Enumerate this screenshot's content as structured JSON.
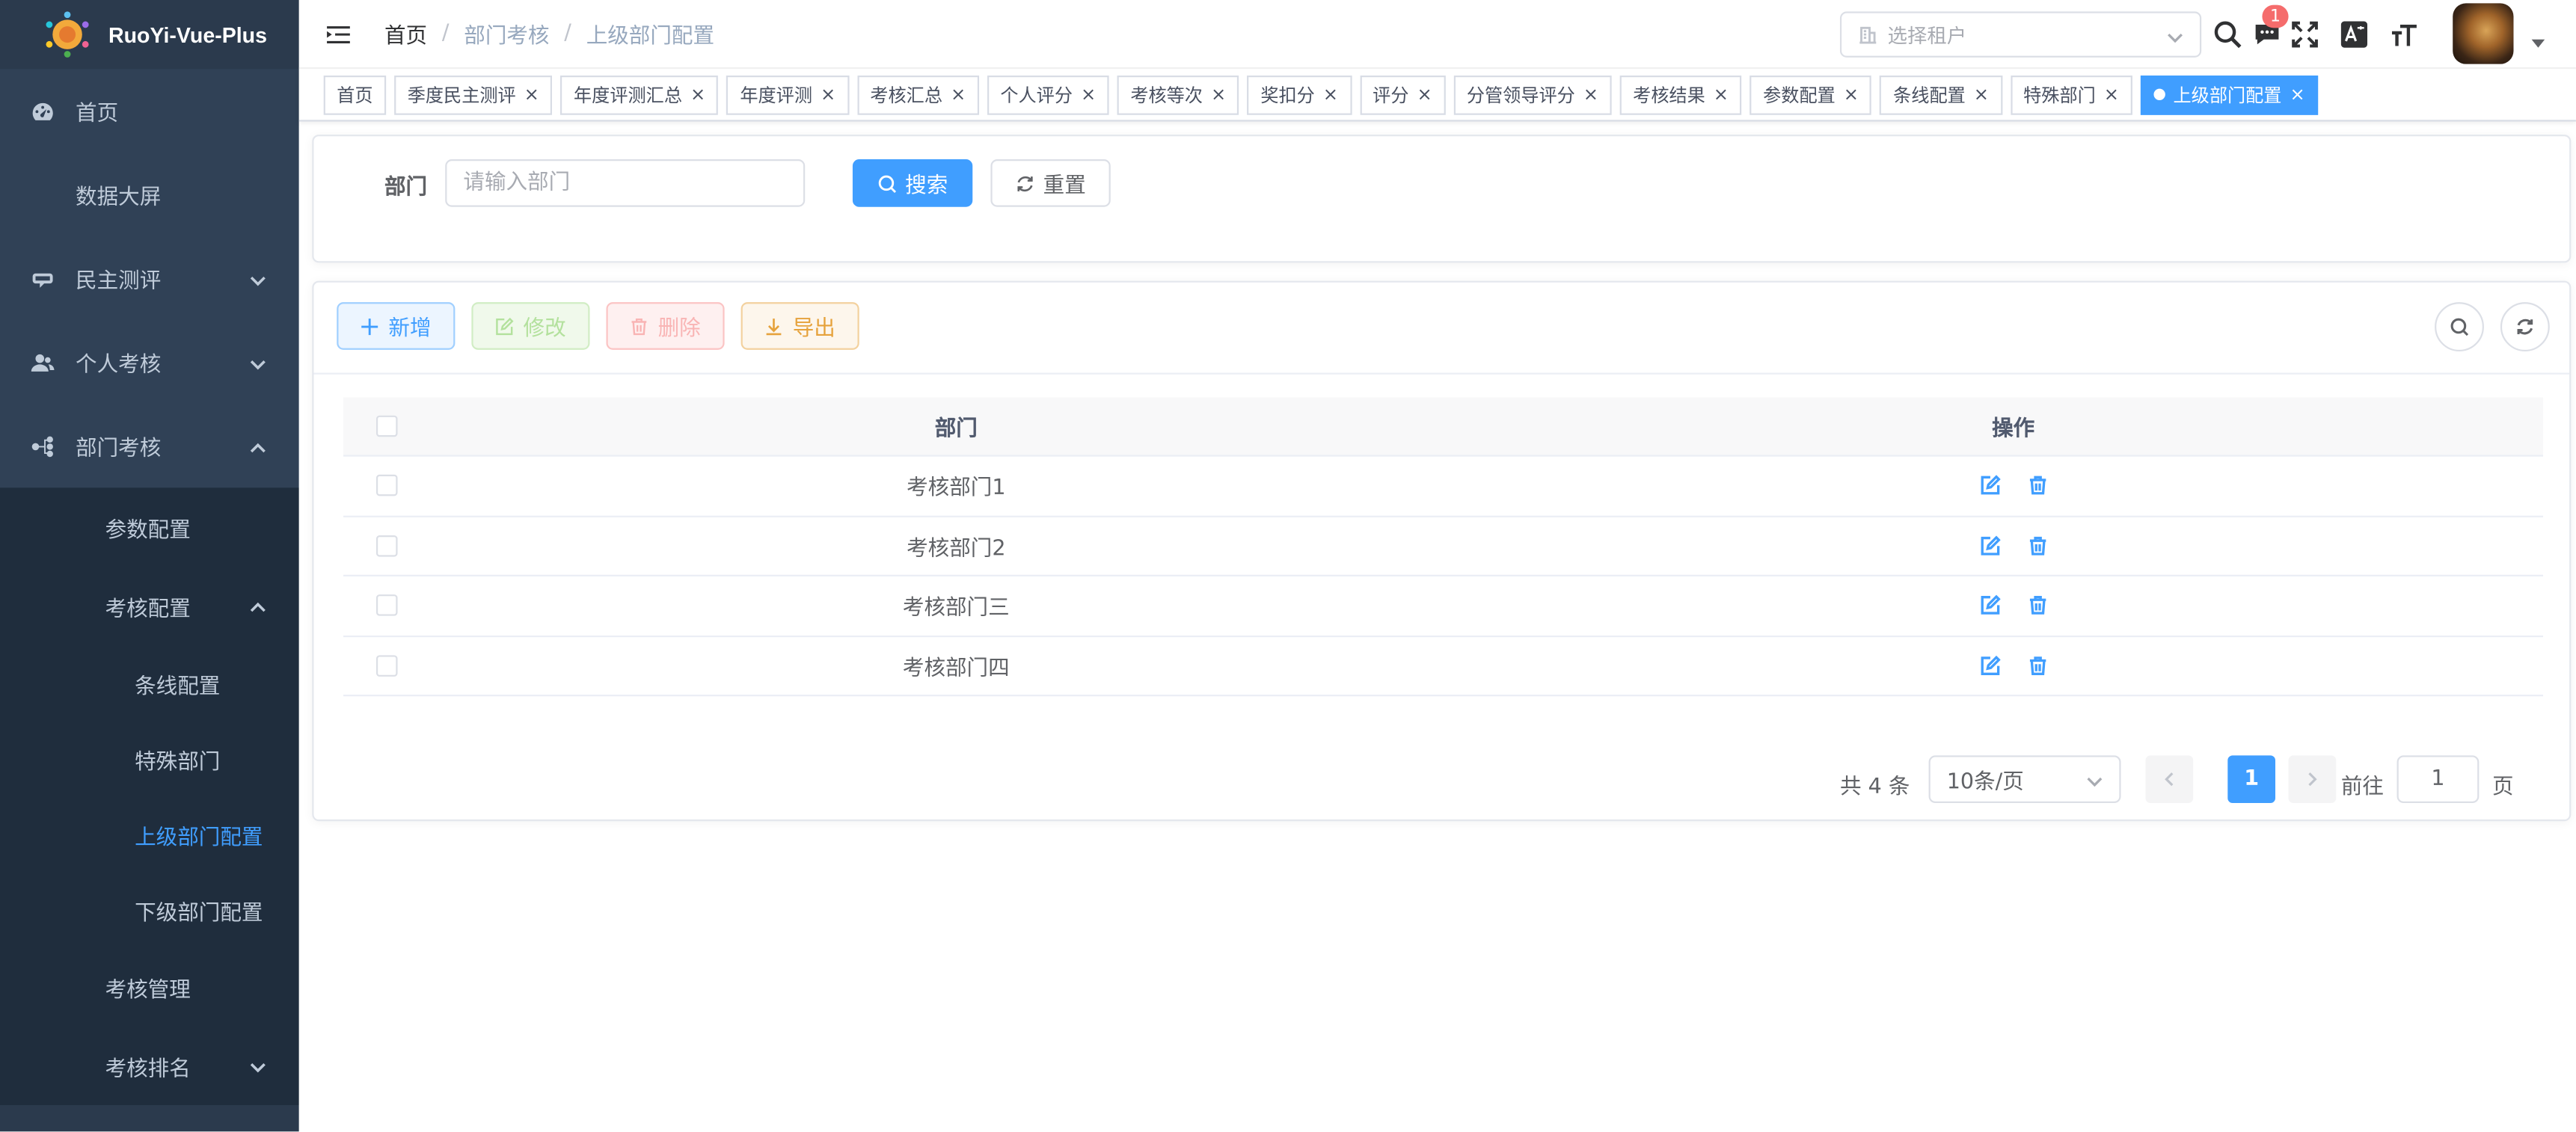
{
  "app": {
    "title": "RuoYi-Vue-Plus"
  },
  "sidebar": {
    "items": [
      {
        "label": "首页",
        "icon": "dashboard-icon"
      },
      {
        "label": "数据大屏"
      },
      {
        "label": "民主测评",
        "icon": "survey-icon"
      },
      {
        "label": "个人考核",
        "icon": "people-icon"
      },
      {
        "label": "部门考核",
        "icon": "tree-icon"
      }
    ],
    "dept_sub": {
      "param": "参数配置",
      "assess": "考核配置",
      "line": "条线配置",
      "special": "特殊部门",
      "upper": "上级部门配置",
      "lower": "下级部门配置",
      "manage": "考核管理",
      "rank": "考核排名"
    }
  },
  "header": {
    "breadcrumb": [
      "首页",
      "部门考核",
      "上级部门配置"
    ],
    "breadcrumb_sep": "/",
    "tenant_placeholder": "选择租户",
    "notify_count": "1"
  },
  "tags": [
    "首页",
    "季度民主测评",
    "年度评测汇总",
    "年度评测",
    "考核汇总",
    "个人评分",
    "考核等次",
    "奖扣分",
    "评分",
    "分管领导评分",
    "考核结果",
    "参数配置",
    "条线配置",
    "特殊部门",
    "上级部门配置"
  ],
  "tag_close": "×",
  "search": {
    "label": "部门",
    "placeholder": "请输入部门",
    "search_btn": "搜索",
    "reset_btn": "重置"
  },
  "toolbar": {
    "add": "新增",
    "edit": "修改",
    "delete": "删除",
    "export": "导出"
  },
  "table": {
    "columns": [
      "部门",
      "操作"
    ],
    "rows": [
      "考核部门1",
      "考核部门2",
      "考核部门三",
      "考核部门四"
    ]
  },
  "pagination": {
    "total": "共 4 条",
    "page_size": "10条/页",
    "current": "1",
    "jump_label": "前往",
    "jump_value": "1",
    "jump_unit": "页"
  },
  "colors": {
    "primary": "#409eff",
    "sidebar_bg": "#304156",
    "submenu_bg": "#1f2d3d"
  }
}
